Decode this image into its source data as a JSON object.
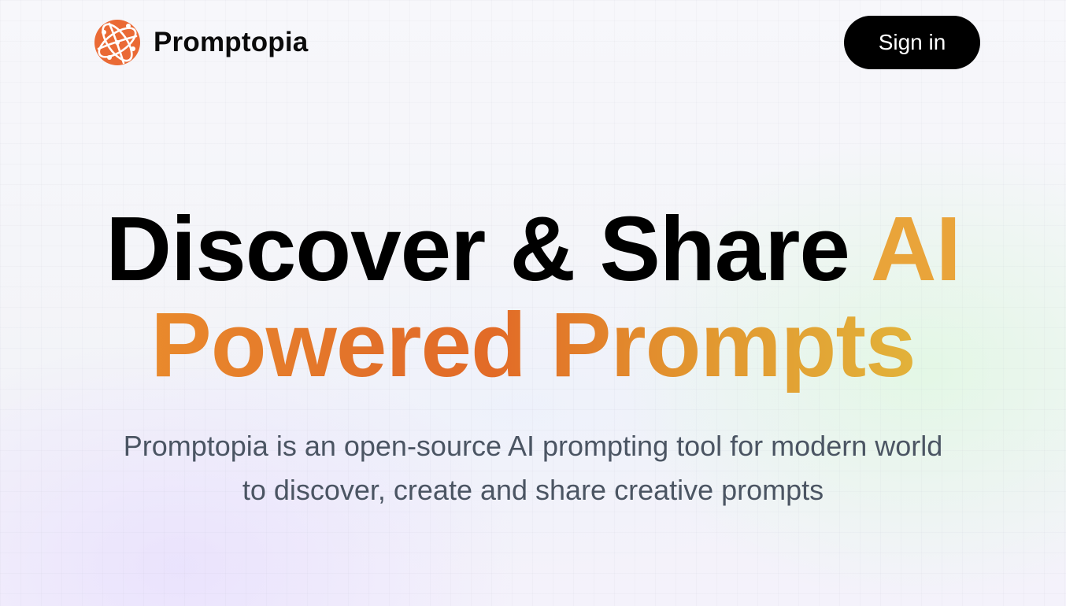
{
  "navbar": {
    "brand_name": "Promptopia",
    "logo_icon": "globe-network-icon",
    "signin_label": "Sign in"
  },
  "hero": {
    "headline_part1": "Discover & Share ",
    "headline_accent": "AI",
    "headline_line2": "Powered Prompts",
    "subtitle": "Promptopia is an open-source AI prompting tool for modern world to discover, create and share creative prompts"
  },
  "colors": {
    "logo": "#ea6a35",
    "button_bg": "#000000",
    "accent_orange": "#e26b27",
    "accent_yellow": "#e2b23a",
    "subtitle_gray": "#4b5563"
  }
}
